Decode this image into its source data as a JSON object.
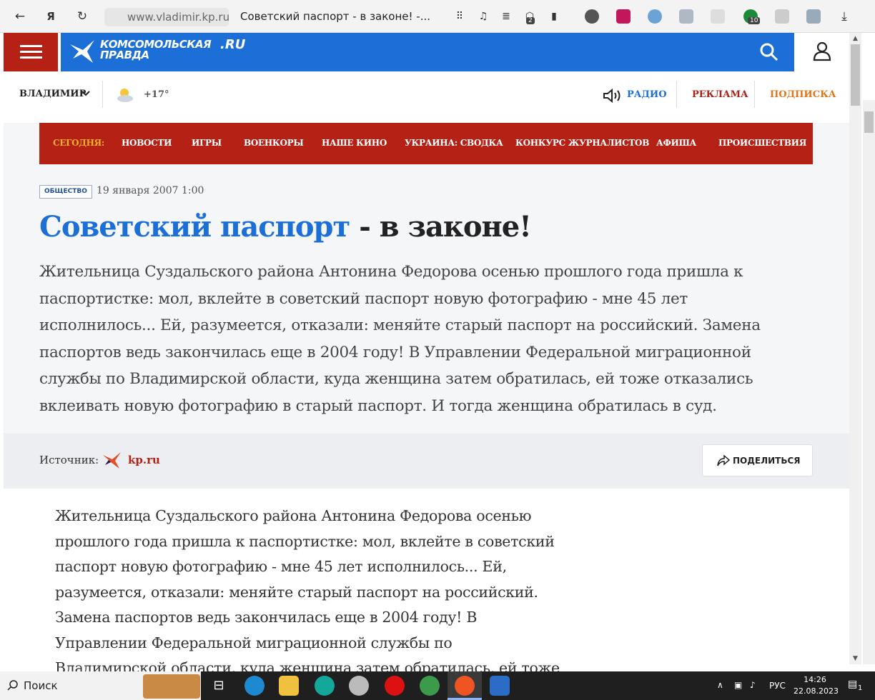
{
  "browser": {
    "url": "www.vladimir.kp.ru",
    "tab_title": "Советский паспорт - в законе! -...",
    "ext_badge_2": "2",
    "ext_badge_10": "10"
  },
  "header": {
    "logo_line1": "КОМСОМОЛЬСКАЯ",
    "logo_line2": "ПРАВДА",
    "logo_ru": ".RU",
    "city": "ВЛАДИМИР",
    "temperature": "+17°",
    "radio": "РАДИО",
    "ads": "РЕКЛАМА",
    "subscription": "ПОДПИСКА"
  },
  "nav": {
    "today": "СЕГОДНЯ:",
    "items": [
      "НОВОСТИ",
      "ИГРЫ",
      "ВОЕНКОРЫ",
      "НАШЕ КИНО",
      "УКРАИНА: СВОДКА",
      "КОНКУРС ЖУРНАЛИСТОВ",
      "АФИША",
      "ПРОИСШЕСТВИЯ"
    ]
  },
  "article": {
    "tag": "ОБЩЕСТВО",
    "date": "19 января 2007 1:00",
    "title_blue": "Советский паспорт",
    "title_rest": " - в законе!",
    "lead": "Жительница Суздальского района Антонина Федорова осенью прошлого года пришла к паспортистке: мол, вклейте в советский паспорт новую фотографию - мне 45 лет исполнилось... Ей, разумеется, отказали: меняйте старый паспорт на российский. Замена паспортов ведь закончилась еще в 2004 году! В Управлении Федеральной миграционной службы по Владимирской области, куда женщина затем обратилась, ей тоже отказались вклеивать новую фотографию в старый паспорт. И тогда женщина обратилась в суд.",
    "source_label": "Источник:",
    "source_link": "kp.ru",
    "share": "ПОДЕЛИТЬСЯ",
    "body": "Жительница Суздальского района Антонина Федорова осенью прошлого года пришла к паспортистке: мол, вклейте в советский паспорт новую фотографию - мне 45 лет исполнилось... Ей, разумеется, отказали: меняйте старый паспорт на российский. Замена паспортов ведь закончилась еще в 2004 году! В Управлении Федеральной миграционной службы по Владимирской области, куда женщина затем обратилась, ей тоже отказались вклеивать"
  },
  "taskbar": {
    "search": "Поиск",
    "lang": "РУС",
    "time": "14:26",
    "date": "22.08.2023",
    "notif_count": "1"
  }
}
